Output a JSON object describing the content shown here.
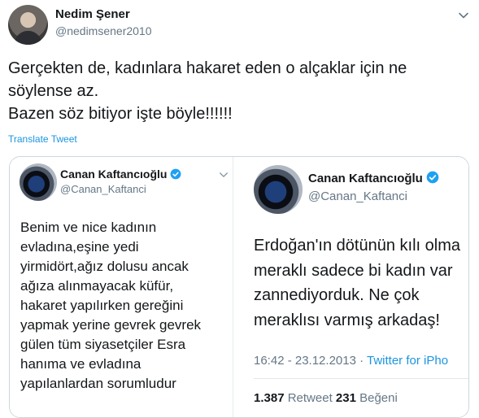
{
  "author": {
    "name": "Nedim Şener",
    "handle": "@nedimsener2010"
  },
  "tweet": {
    "lines": [
      "Gerçekten de, kadınlara hakaret eden o alçaklar için ne",
      "söylense az.",
      "Bazen söz bitiyor işte böyle!!!!!!"
    ],
    "translate_label": "Translate Tweet"
  },
  "quoted_left": {
    "name": "Canan Kaftancıoğlu",
    "handle": "@Canan_Kaftanci",
    "lines": [
      "Benim ve nice kadının",
      "evladına,eşine yedi",
      "yirmidört,ağız dolusu ancak",
      "ağıza alınmayacak küfür,",
      "hakaret yapılırken  gereğini",
      "yapmak yerine gevrek gevrek",
      "gülen tüm siyasetçiler Esra",
      "hanıma ve evladına",
      "yapılanlardan sorumludur"
    ]
  },
  "quoted_right": {
    "name": "Canan Kaftancıoğlu",
    "handle": "@Canan_Kaftanci",
    "lines": [
      "Erdoğan'ın  dötünün kılı olma",
      "meraklı sadece bi kadın var",
      "zannediyorduk. Ne çok",
      "meraklısı varmış arkadaş!"
    ],
    "timestamp": "16:42 - 23.12.2013 · ",
    "source": "Twitter for iPho",
    "retweets_count": "1.387",
    "retweets_label": " Retweet ",
    "likes_count": "231",
    "likes_label": " Beğeni"
  },
  "colors": {
    "link": "#1b95e0",
    "verified": "#1da1f2",
    "muted": "#657786"
  }
}
